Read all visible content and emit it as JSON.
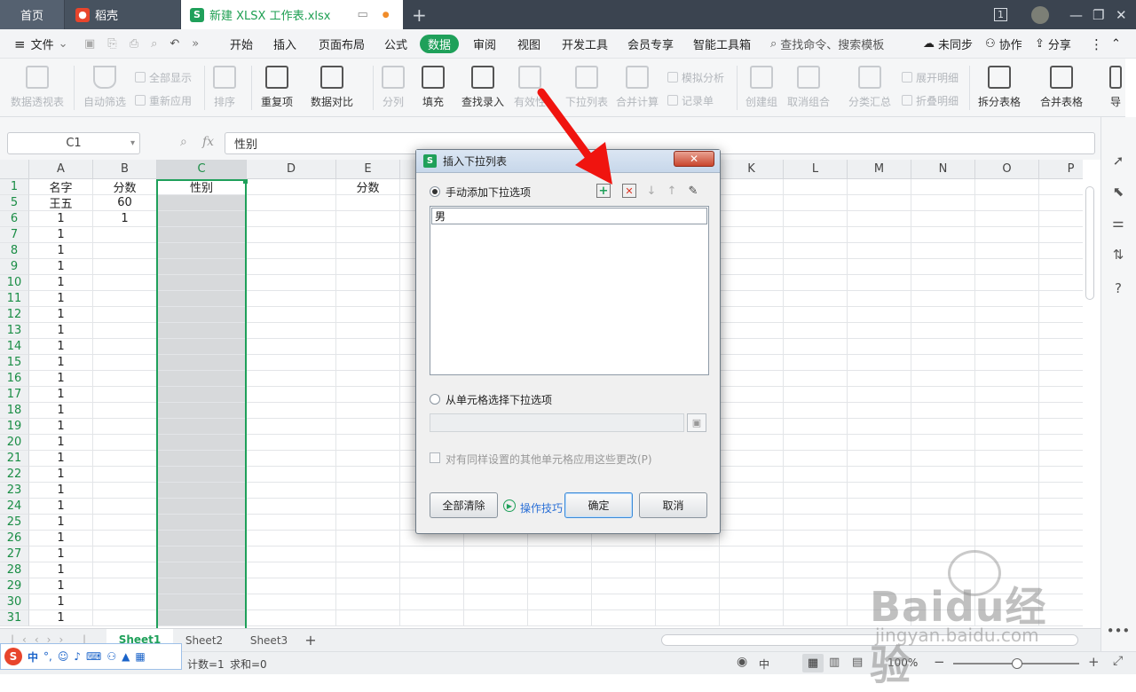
{
  "tabs": {
    "home": "首页",
    "daoke": "稻壳",
    "file": "新建 XLSX 工作表.xlsx",
    "window_count": "1"
  },
  "menu": {
    "file": "文件",
    "items": [
      "开始",
      "插入",
      "页面布局",
      "公式",
      "数据",
      "审阅",
      "视图",
      "开发工具",
      "会员专享",
      "智能工具箱"
    ],
    "active": "数据",
    "search": "查找命令、搜索模板",
    "sync": "未同步",
    "collab": "协作",
    "share": "分享"
  },
  "ribbon": {
    "pivot": "数据透视表",
    "autofilter": "自动筛选",
    "show_all": "全部显示",
    "reapply": "重新应用",
    "sort": "排序",
    "duplicates": "重复项",
    "compare": "数据对比",
    "split": "分列",
    "fill": "填充",
    "lookup": "查找录入",
    "validity": "有效性",
    "dropdown": "下拉列表",
    "consolidate": "合并计算",
    "whatif": "模拟分析",
    "record": "记录单",
    "group": "创建组",
    "ungroup": "取消组合",
    "subtotal": "分类汇总",
    "expand": "展开明细",
    "collapse": "折叠明细",
    "split_table": "拆分表格",
    "merge_table": "合并表格",
    "more": "导"
  },
  "formula": {
    "cell_ref": "C1",
    "fx": "fx",
    "value": "性别"
  },
  "grid": {
    "columns": [
      "A",
      "B",
      "C",
      "D",
      "E",
      "F",
      "G",
      "H",
      "I",
      "J",
      "K",
      "L",
      "M",
      "N",
      "O",
      "P"
    ],
    "rows": [
      "1",
      "5",
      "6",
      "7",
      "8",
      "9",
      "10",
      "11",
      "12",
      "13",
      "14",
      "15",
      "16",
      "17",
      "18",
      "19",
      "20",
      "21",
      "22",
      "23",
      "24",
      "25",
      "26",
      "27",
      "28",
      "29",
      "30",
      "31"
    ],
    "cells": [
      {
        "A": "名字",
        "B": "分数",
        "C": "性别",
        "E": "分数"
      },
      {
        "A": "王五",
        "B": "60"
      },
      {
        "A": "1",
        "B": "1"
      },
      {
        "A": "1"
      },
      {
        "A": "1"
      },
      {
        "A": "1"
      },
      {
        "A": "1"
      },
      {
        "A": "1"
      },
      {
        "A": "1"
      },
      {
        "A": "1"
      },
      {
        "A": "1"
      },
      {
        "A": "1"
      },
      {
        "A": "1"
      },
      {
        "A": "1"
      },
      {
        "A": "1"
      },
      {
        "A": "1"
      },
      {
        "A": "1"
      },
      {
        "A": "1"
      },
      {
        "A": "1"
      },
      {
        "A": "1"
      },
      {
        "A": "1"
      },
      {
        "A": "1"
      },
      {
        "A": "1"
      },
      {
        "A": "1"
      },
      {
        "A": "1"
      },
      {
        "A": "1"
      },
      {
        "A": "1"
      },
      {
        "A": "1"
      }
    ]
  },
  "sheets": {
    "tabs": [
      "Sheet1",
      "Sheet2",
      "Sheet3"
    ],
    "active": "Sheet1"
  },
  "status": {
    "count": "计数=1",
    "sum": "求和=0",
    "zoom": "100%",
    "ime": "中"
  },
  "dialog": {
    "title": "插入下拉列表",
    "manual": "手动添加下拉选项",
    "from_cells": "从单元格选择下拉选项",
    "apply_all": "对有同样设置的其他单元格应用这些更改(P)",
    "items": [
      "男"
    ],
    "clear_all": "全部清除",
    "tips": "操作技巧",
    "ok": "确定",
    "cancel": "取消"
  },
  "watermark": {
    "brand": "Baidu经验",
    "url": "jingyan.baidu.com"
  }
}
